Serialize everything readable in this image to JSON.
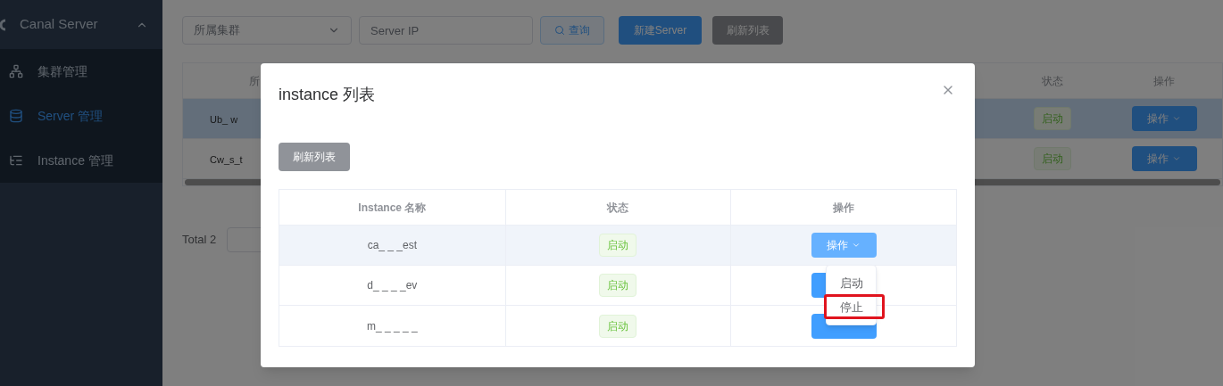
{
  "sidebar": {
    "title": "Canal Server",
    "expanded": true,
    "items": [
      {
        "label": "集群管理",
        "selected": false
      },
      {
        "label": "Server 管理",
        "selected": true
      },
      {
        "label": "Instance 管理",
        "selected": false
      }
    ]
  },
  "toolbar": {
    "cluster_select": {
      "placeholder": "所属集群"
    },
    "ip_field": {
      "placeholder": "Server IP"
    },
    "buttons": [
      {
        "label": "查询",
        "kind": "search"
      },
      {
        "label": "新建Server",
        "kind": "primary"
      },
      {
        "label": "刷新列表",
        "kind": "info"
      }
    ]
  },
  "server_table": {
    "columns": [
      "所",
      "状态",
      "操作"
    ],
    "rows": [
      {
        "name": "Ub_ w",
        "status": "启动",
        "action": "操作",
        "selected": true
      },
      {
        "name": "Cw_s_t",
        "status": "启动",
        "action": "操作",
        "selected": false
      }
    ]
  },
  "pagination": {
    "total": "Total 2"
  },
  "dialog": {
    "title": "instance 列表",
    "refresh_button": "刷新列表",
    "columns": [
      "Instance 名称",
      "状态",
      "操作"
    ],
    "rows": [
      {
        "name": "ca_ _ _est",
        "status": "启动",
        "action": "操作",
        "selected": true
      },
      {
        "name": "d_ _ _ _ev",
        "status": "启动",
        "selected": false
      },
      {
        "name": "m_ _ _ _ _",
        "status": "启动",
        "selected": false
      }
    ],
    "dropdown": {
      "items": [
        {
          "label": "启动",
          "highlighted": false
        },
        {
          "label": "停止",
          "highlighted": true
        }
      ]
    }
  }
}
